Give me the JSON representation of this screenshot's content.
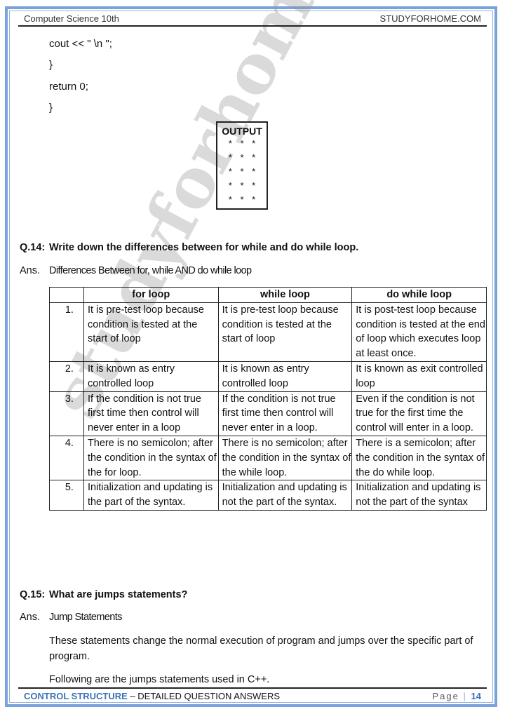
{
  "header": {
    "left": "Computer Science 10th",
    "right": "STUDYFORHOME.COM"
  },
  "code_lines": [
    "cout <<  \" \\n \";",
    "}",
    "return 0;",
    "}"
  ],
  "output_box": {
    "title": "OUTPUT",
    "rows": [
      "* * *",
      "* * *",
      "* * *",
      "* * *",
      "* * *"
    ]
  },
  "q14": {
    "number": "Q.14:",
    "question": "Write down the differences between for while and do while loop.",
    "ans_label": "Ans.",
    "ans_heading": "Differences Between for, while AND do while loop"
  },
  "table": {
    "headers": [
      "",
      "for loop",
      "while loop",
      "do while loop"
    ],
    "rows": [
      [
        "1.",
        "It is pre-test loop because condition is tested at the start of loop",
        "It is pre-test loop because condition is tested at the start of loop",
        "It is post-test loop because condition is tested at the end of loop which executes loop at least once."
      ],
      [
        "2.",
        "It is known as entry controlled loop",
        "It is known as entry controlled loop",
        "It is known as exit controlled loop"
      ],
      [
        "3.",
        "If the condition is not true first time then control will never enter in a loop",
        "If the condition is not true first time then control will never enter in a loop.",
        "Even if the condition is not true for the first time the control will enter in a loop."
      ],
      [
        "4.",
        "There is no semicolon; after the condition in the syntax of the for loop.",
        "There is no semicolon; after the condition in the syntax of the while loop.",
        "There is a semicolon; after the condition in the syntax of the do while loop."
      ],
      [
        "5.",
        "Initialization and updating is the part of the syntax.",
        "Initialization and updating is not the part of the syntax.",
        "Initialization and updating is not the part of the syntax"
      ]
    ]
  },
  "q15": {
    "number": "Q.15:",
    "question": "What are jumps statements?",
    "ans_label": "Ans.",
    "ans_heading": "Jump Statements",
    "paragraphs": [
      "These statements change the normal execution of program and jumps over the specific part of program.",
      "Following are the jumps statements used in C++."
    ]
  },
  "footer": {
    "chapter": "CONTROL STRUCTURE",
    "subtitle": " – DETAILED QUESTION ANSWERS",
    "page_label": "Page",
    "page_sep": "|",
    "page_number": "14"
  },
  "watermark": "studyforhome.com",
  "colors": {
    "frame": "#7aa3dc",
    "accent": "#3b73b9"
  }
}
